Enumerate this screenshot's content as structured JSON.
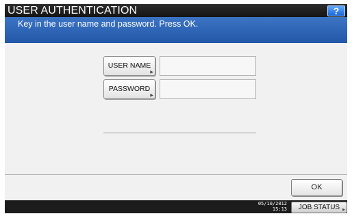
{
  "header": {
    "title": "USER AUTHENTICATION",
    "help_label": "?"
  },
  "message": {
    "text": "Key in the user name and password. Press OK."
  },
  "form": {
    "username_label": "USER NAME",
    "password_label": "PASSWORD",
    "username_value": "",
    "password_value": ""
  },
  "actions": {
    "ok_label": "OK"
  },
  "status_bar": {
    "date": "05/10/2012",
    "time": "15:13",
    "job_status_label": "JOB STATUS"
  },
  "icons": {
    "button_arrow": "small-right-arrow-icon"
  },
  "colors": {
    "title_bar": "#1e1e1e",
    "message_bar": "#2f66b8",
    "help_button": "#2b7de9",
    "panel": "#f1f1f1",
    "status_bar": "#1c1c1c"
  }
}
